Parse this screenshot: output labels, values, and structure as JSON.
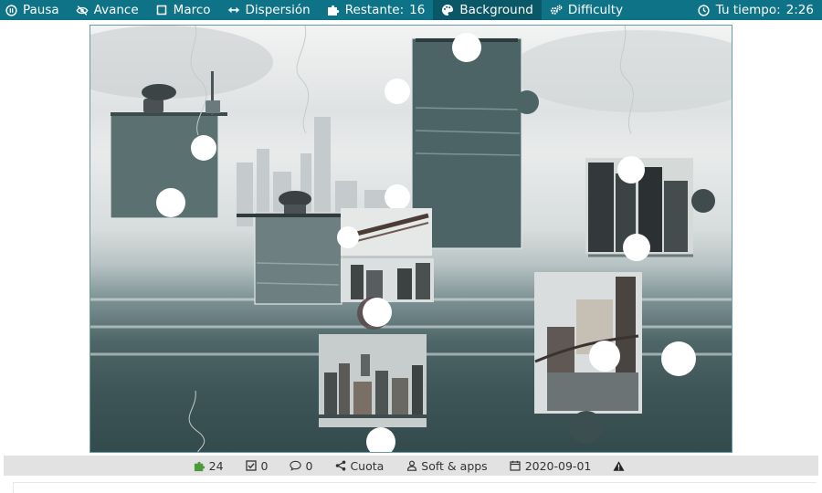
{
  "toolbar": {
    "pause": {
      "label": "Pausa",
      "icon": "pause-circle-icon"
    },
    "progress": {
      "label": "Avance",
      "icon": "eye-slash-icon"
    },
    "frame": {
      "label": "Marco",
      "icon": "square-icon"
    },
    "scatter": {
      "label": "Dispersión",
      "icon": "arrows-horizontal-icon"
    },
    "remaining": {
      "label": "Restante:",
      "value": "16",
      "icon": "puzzle-piece-icon"
    },
    "background": {
      "label": "Background",
      "icon": "palette-icon"
    },
    "difficulty": {
      "label": "Difficulty",
      "icon": "cogs-icon"
    },
    "timer": {
      "label": "Tu tiempo:",
      "value": "2:26",
      "icon": "clock-icon"
    }
  },
  "status": {
    "pieces": "24",
    "completed": "0",
    "comments": "0",
    "share": "Cuota",
    "author": "Soft & apps",
    "date": "2020-09-01"
  },
  "colors": {
    "toolbar_bg": "#0f7388",
    "toolbar_active": "#0a5767",
    "status_bg": "#e2e2e2",
    "puzzle_green": "#4c9a3a",
    "board_border": "#6a9aa3"
  }
}
